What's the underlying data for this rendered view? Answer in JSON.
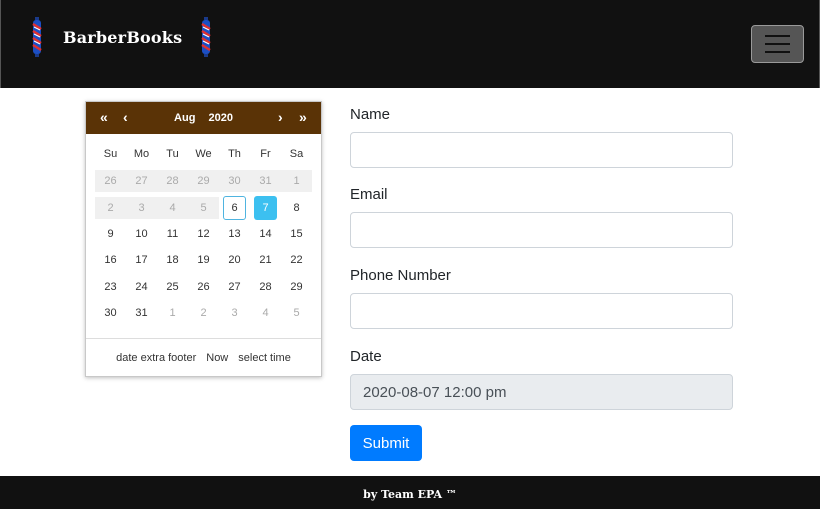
{
  "navbar": {
    "brand": "BarberBooks",
    "left_icon": "barber-pole-icon",
    "right_icon": "barber-pole-icon",
    "menu_icon": "hamburger-menu-icon",
    "background": "#111111"
  },
  "calendar": {
    "prev_year": "«",
    "prev_month": "‹",
    "next_month": "›",
    "next_year": "»",
    "month": "Aug",
    "year": "2020",
    "header_color": "#5a3306",
    "selected_color": "#3cc0f0",
    "weekdays": [
      "Su",
      "Mo",
      "Tu",
      "We",
      "Th",
      "Fr",
      "Sa"
    ],
    "weeks": [
      [
        "26",
        "27",
        "28",
        "29",
        "30",
        "31",
        "1"
      ],
      [
        "2",
        "3",
        "4",
        "5",
        "6",
        "7",
        "8"
      ],
      [
        "9",
        "10",
        "11",
        "12",
        "13",
        "14",
        "15"
      ],
      [
        "16",
        "17",
        "18",
        "19",
        "20",
        "21",
        "22"
      ],
      [
        "23",
        "24",
        "25",
        "26",
        "27",
        "28",
        "29"
      ],
      [
        "30",
        "31",
        "1",
        "2",
        "3",
        "4",
        "5"
      ]
    ],
    "today": "6",
    "selected": "7",
    "footer": {
      "extra": "date extra footer",
      "now": "Now",
      "select_time": "select time"
    }
  },
  "form": {
    "name_label": "Name",
    "name_value": "",
    "email_label": "Email",
    "email_value": "",
    "phone_label": "Phone Number",
    "phone_value": "",
    "date_label": "Date",
    "date_value": "2020-08-07 12:00 pm",
    "submit_label": "Submit",
    "submit_color": "#007bff"
  },
  "footer": {
    "text": "by Team EPA ™"
  }
}
